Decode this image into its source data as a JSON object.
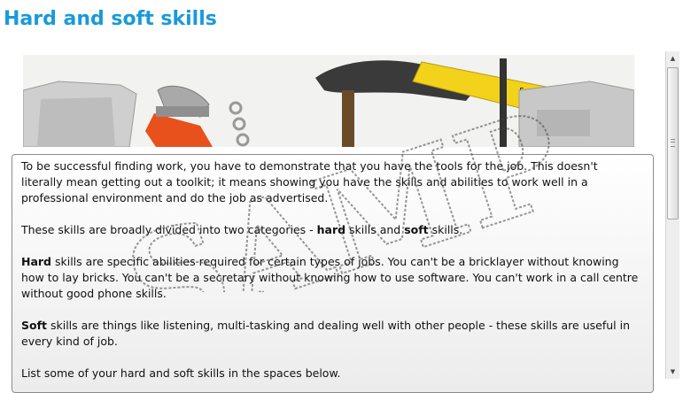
{
  "page": {
    "title": "Hard and soft skills"
  },
  "banner": {
    "alt": "tools-banner-image",
    "watermark_text": "SAMPLE"
  },
  "content": {
    "p1": "To be successful finding work, you have to demonstrate that you have the tools for the job. This doesn't literally mean getting out a toolkit; it means showing you have the skills and abilities to work well in a professional environment and do the job as advertised.",
    "p2_before": "These skills are broadly divided into two categories - ",
    "p2_hard": "hard",
    "p2_mid": " skills and ",
    "p2_soft": "soft",
    "p2_after": " skills.",
    "p3_bold": "Hard",
    "p3_rest": " skills are specific abilities required for certain types of jobs. You can't be a bricklayer without knowing how to lay bricks. You can't be a secretary without knowing how to use software. You can't work in a call centre without good phone skills.",
    "p4_bold": "Soft",
    "p4_rest": " skills are things like listening, multi-tasking and dealing well with other people - these skills are useful in every kind of job.",
    "p5": "List some of your hard and soft skills in the spaces below."
  },
  "colors": {
    "title": "#1a9ad9",
    "tape": "#f2d21a",
    "wrench": "#e8501c"
  },
  "scrollbar": {
    "up_icon": "arrow-up-icon",
    "down_icon": "arrow-down-icon"
  }
}
